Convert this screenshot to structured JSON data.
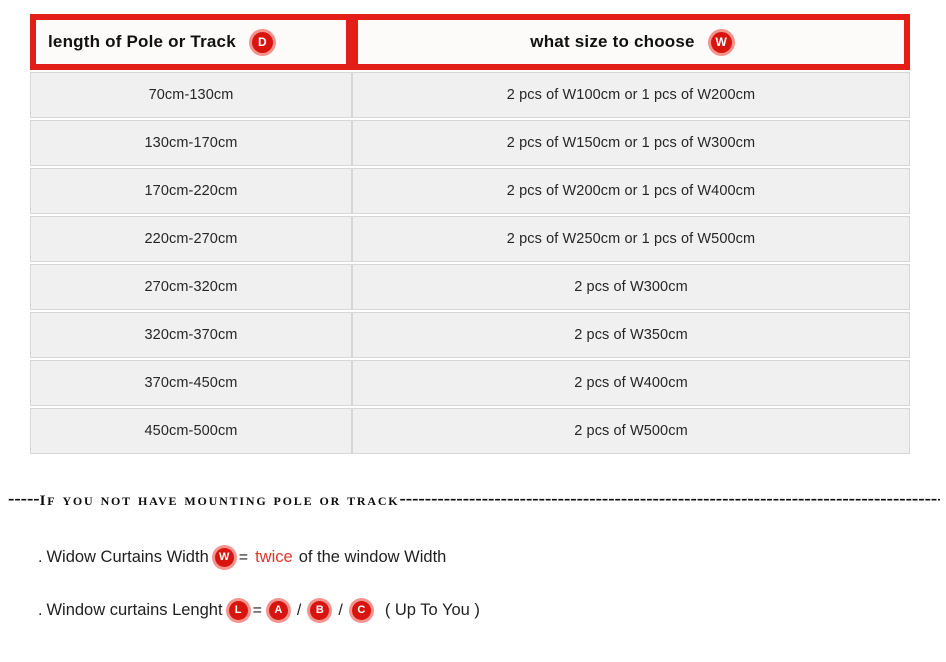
{
  "table": {
    "headers": [
      {
        "label": "length of  Pole or Track",
        "badge": "D"
      },
      {
        "label": "what  size to choose",
        "badge": "W"
      }
    ],
    "rows": [
      {
        "length": "70cm-130cm",
        "size": "2 pcs of W100cm or 1 pcs of W200cm"
      },
      {
        "length": "130cm-170cm",
        "size": "2 pcs of W150cm or 1 pcs of W300cm"
      },
      {
        "length": "170cm-220cm",
        "size": "2 pcs of W200cm or 1 pcs of W400cm"
      },
      {
        "length": "220cm-270cm",
        "size": "2 pcs of W250cm or 1 pcs of W500cm"
      },
      {
        "length": "270cm-320cm",
        "size": "2 pcs of W300cm"
      },
      {
        "length": "320cm-370cm",
        "size": "2 pcs of W350cm"
      },
      {
        "length": "370cm-450cm",
        "size": "2 pcs of W400cm"
      },
      {
        "length": "450cm-500cm",
        "size": "2 pcs of W500cm"
      }
    ]
  },
  "notes": {
    "divider": {
      "lead_dashes": "-----",
      "caps_text": "If you not have mounting pole or track",
      "trail_dashes": "--------------------------------------------------------------------------------------------------------------"
    },
    "line1": {
      "bullet": ".",
      "text": "Widow Curtains Width",
      "badge": "W",
      "equals": "=",
      "emphasis": "twice",
      "suffix": "of the window Width"
    },
    "line2": {
      "bullet": ".",
      "text": "Window  curtains Lenght",
      "badge": "L",
      "equals": "=",
      "options": [
        "A",
        "B",
        "C"
      ],
      "separator": "/",
      "suffix": "( Up To You )"
    }
  },
  "colors": {
    "accent_red": "#e31e18",
    "badge_red": "#d8140e",
    "cell_bg": "#f0f0f0",
    "page_bg": "#ffffff"
  }
}
